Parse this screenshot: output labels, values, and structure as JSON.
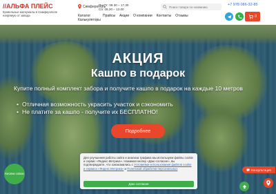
{
  "header": {
    "logo_text": "//АЛЬФА ПЛЕЙС",
    "logo_tagline": "Кровельные материалы в Симферополе напрямую от завода",
    "city": "Симферополь",
    "hours_weekdays": "Пн-Пт: 08.30 – 17.30",
    "hours_saturday": "Сб: 08.30 – 13.00",
    "search_placeholder": "Поиск товара по названию",
    "phone": "+7 978 086-32-85",
    "nav": [
      "Каталог",
      "Прайсы",
      "Акции",
      "О компании",
      "Контакты",
      "Отзывы"
    ],
    "nav_extra": "Калькуляторы",
    "cart_count": "0"
  },
  "hero": {
    "title": "АКЦИЯ",
    "subtitle": "Кашпо в подарок",
    "lead": "Купите полный комплект забора и получите кашпо в подарок на каждые 10 метров",
    "bullets": [
      "Отличная возможность украсить участок и сэкономить",
      "Не платите за кашпо - получите их БЕСПЛАТНО!"
    ],
    "cta_label": "Подробнее"
  },
  "cookie": {
    "text_before": "Для улучшения работы сайта и анализа трафика мы используем файлы cookie и сервис «Яндекс.Метрика». Нажимая кнопку «Даю согласие», вы подтверждаете, что ознакомились с ",
    "link1": "Условиями использования файлов cookie и сервиса «Яндекс.Метрика»",
    "text_middle": " и ",
    "link2": "Политикой обработки персональных",
    "button_label": "Даю согласие"
  },
  "floating": {
    "left_button": "Кнопки связи",
    "consult_label": "Консультация"
  },
  "colors": {
    "brand_red": "#e8472b",
    "green": "#3fae4a",
    "telegram": "#2ea6da"
  }
}
